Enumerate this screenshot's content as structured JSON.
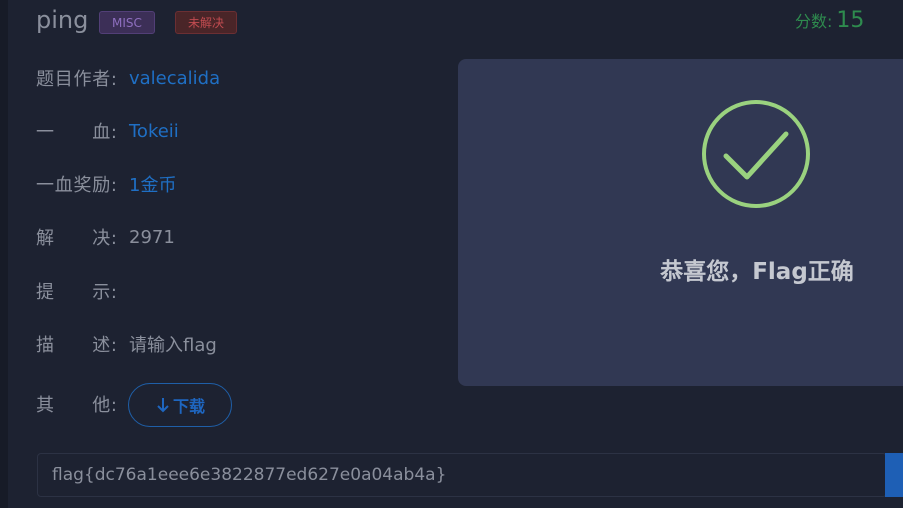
{
  "challenge": {
    "name": "ping",
    "category_badge": "MISC",
    "status_badge": "未解决",
    "score_label": "分数:",
    "score_value": "15"
  },
  "details": [
    {
      "label": "题目作者:",
      "value": "valecalida",
      "is_link": true
    },
    {
      "label": "一　　血:",
      "value": "Tokeii",
      "is_link": true
    },
    {
      "label": "一血奖励:",
      "value": "1金币",
      "is_link": true
    },
    {
      "label": "解　　决:",
      "value": "2971",
      "is_link": false
    },
    {
      "label": "提　　示:",
      "value": "",
      "is_link": false
    },
    {
      "label": "描　　述:",
      "value": "请输入flag",
      "is_link": false
    },
    {
      "label": "其　　他:",
      "value": "",
      "is_link": false
    }
  ],
  "download_button": {
    "label": "下载",
    "icon": "arrow-down-icon"
  },
  "flag_input": {
    "value": "flag{dc76a1eee6e3822877ed627e0a04ab4a}"
  },
  "modal": {
    "message": "恭喜您，Flag正确",
    "icon": "check-circle-icon",
    "icon_color": "#9ad27f"
  },
  "colors": {
    "link": "#1f6fc4",
    "score": "#2e8b4e",
    "modal_bg": "#313853"
  }
}
